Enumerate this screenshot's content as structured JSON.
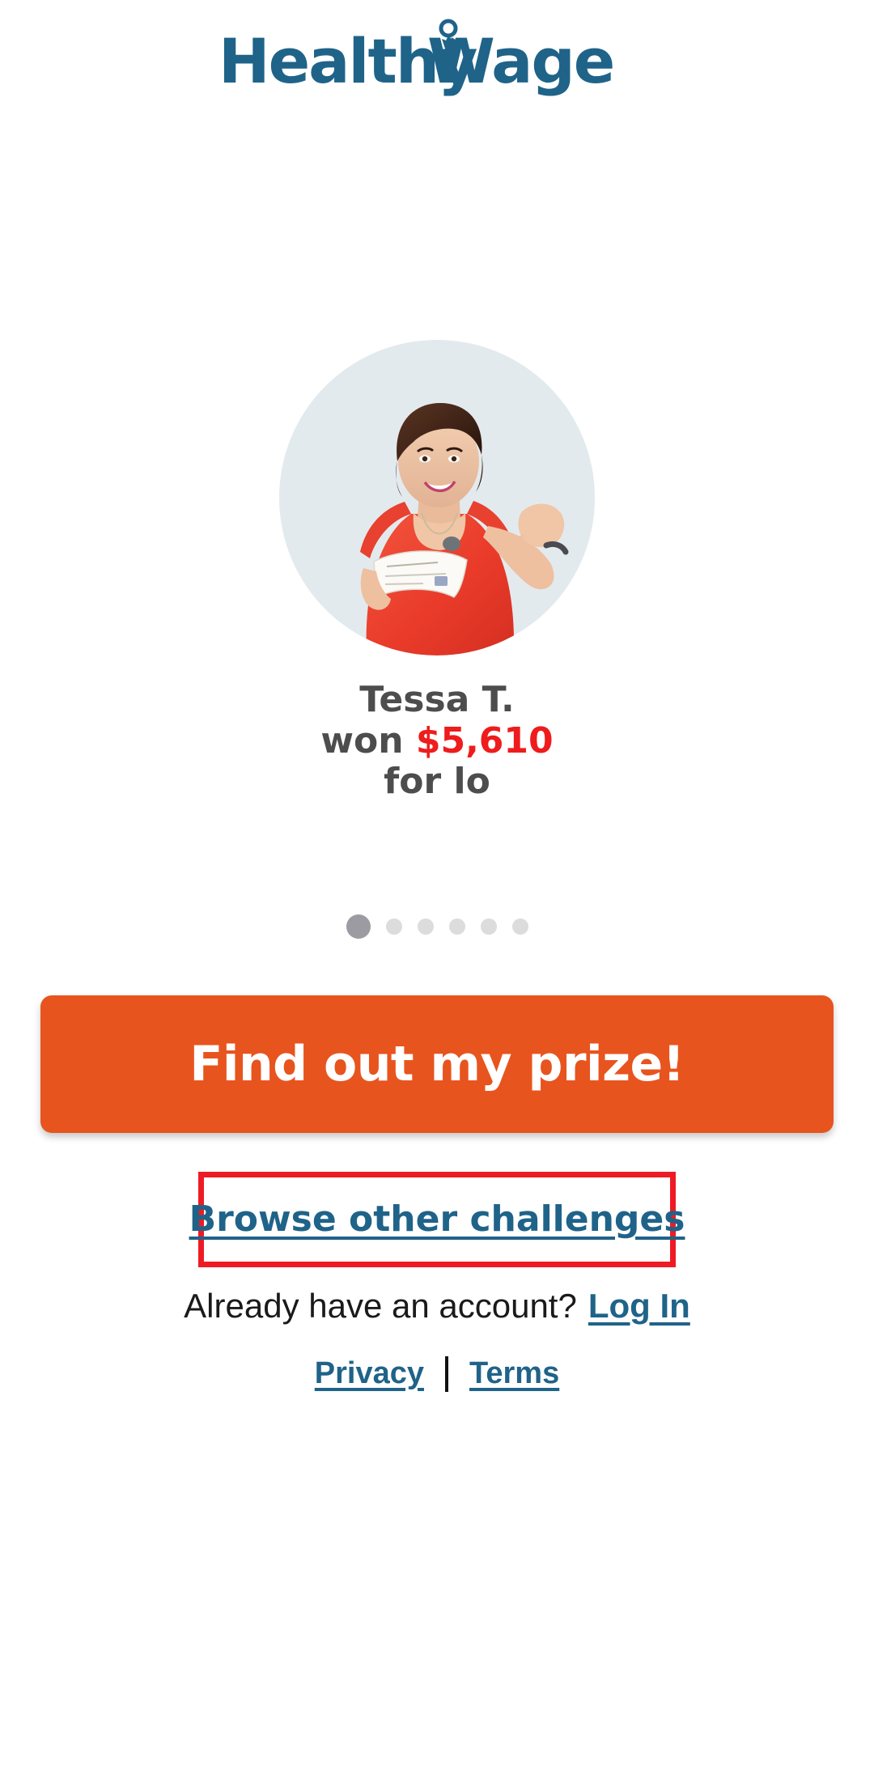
{
  "brand": {
    "logo_text_part1": "Healthy",
    "logo_text_part2": "Wage",
    "logo_color": "#1f6389",
    "rosette_icon": "award-ribbon-icon"
  },
  "hero": {
    "avatar_alt": "winner-photo-woman-holding-check",
    "avatar_bg_color": "#e3eaee",
    "testimonial": {
      "name": "Tessa T.",
      "won_label": "won",
      "amount": "$5,610",
      "amount_color": "#ee1c1c",
      "reason_text": "for lo"
    }
  },
  "carousel": {
    "total_dots": 6,
    "active_index": 0,
    "active_color": "#9b9ba1",
    "inactive_color": "#dcdcdc"
  },
  "cta": {
    "label": "Find out my prize!",
    "bg_color": "#e8541e",
    "text_color": "#ffffff"
  },
  "secondary": {
    "browse_label": "Browse other challenges",
    "highlight_color": "#ef1b24",
    "link_color": "#1f6389"
  },
  "account": {
    "prompt": "Already have an account?",
    "login_label": "Log In"
  },
  "footer": {
    "privacy_label": "Privacy",
    "separator": "|",
    "terms_label": "Terms"
  }
}
